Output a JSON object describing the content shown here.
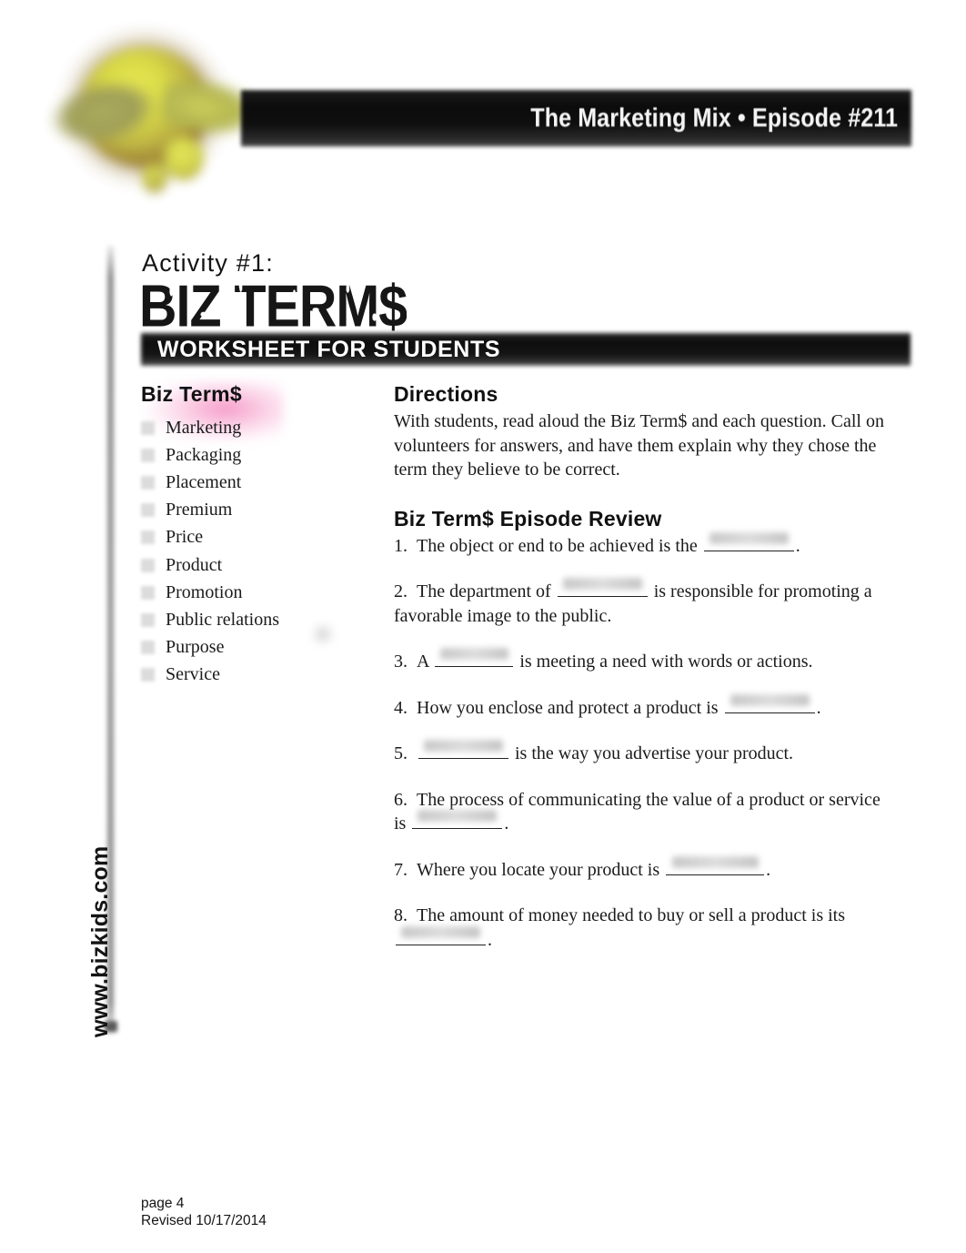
{
  "header": {
    "logo_alt": "Biz Kid$ logo",
    "episode_banner": {
      "show_title": "The Marketing Mix",
      "separator": "•",
      "episode_prefix": "Episode",
      "episode_sup": "#",
      "episode_number": "211",
      "full_text": "The Marketing Mix • Episode #211"
    }
  },
  "title_block": {
    "activity_label": "Activity #1:",
    "headline": "BIZ TERM$",
    "worksheet_bar": "WORKSHEET FOR STUDENTS"
  },
  "terms_panel": {
    "heading": "Biz Term$",
    "highlighted_term": "Marketing",
    "highlight_color": "#f48cc0",
    "bullet_color": "#dcdcdc",
    "items": [
      {
        "label": "Marketing"
      },
      {
        "label": "Packaging"
      },
      {
        "label": "Placement"
      },
      {
        "label": "Premium"
      },
      {
        "label": "Price"
      },
      {
        "label": "Product"
      },
      {
        "label": "Promotion"
      },
      {
        "label": "Public relations"
      },
      {
        "label": "Purpose"
      },
      {
        "label": "Service"
      }
    ]
  },
  "directions": {
    "heading": "Directions",
    "body": "With students, read aloud the Biz Term$ and each question.  Call on volunteers for answers, and have them explain why they chose the term they believe to be correct."
  },
  "review": {
    "heading": "Biz Term$ Episode Review",
    "questions": [
      {
        "number": "1.",
        "before": "The object or end to be achieved is the",
        "blank_size": "w-md",
        "after": "."
      },
      {
        "number": "2.",
        "before": "The department of",
        "blank_size": "w-md",
        "after": "is responsible for promoting a favor­able image to the public."
      },
      {
        "number": "3.",
        "before": "A",
        "blank_size": "w-sm",
        "after": "is meeting a need with words or actions."
      },
      {
        "number": "4.",
        "before": "How you enclose and protect a product is",
        "blank_size": "w-md",
        "after": "."
      },
      {
        "number": "5.",
        "before": "",
        "blank_size": "w-md",
        "after": "is the way you advertise your product."
      },
      {
        "number": "6.",
        "before": "The process of communicating the value of a product or service is",
        "blank_size": "w-md",
        "after": "."
      },
      {
        "number": "7.",
        "before": "Where you locate your product is",
        "blank_size": "w-lg",
        "after": "."
      },
      {
        "number": "8.",
        "before": "The amount of money needed to buy or sell a product is its",
        "blank_size": "w-md",
        "after": "."
      }
    ]
  },
  "footer": {
    "vertical_url": "www.bizkids.com",
    "page_label": "page 4",
    "revised_label": "Revised 10/17/2014"
  }
}
